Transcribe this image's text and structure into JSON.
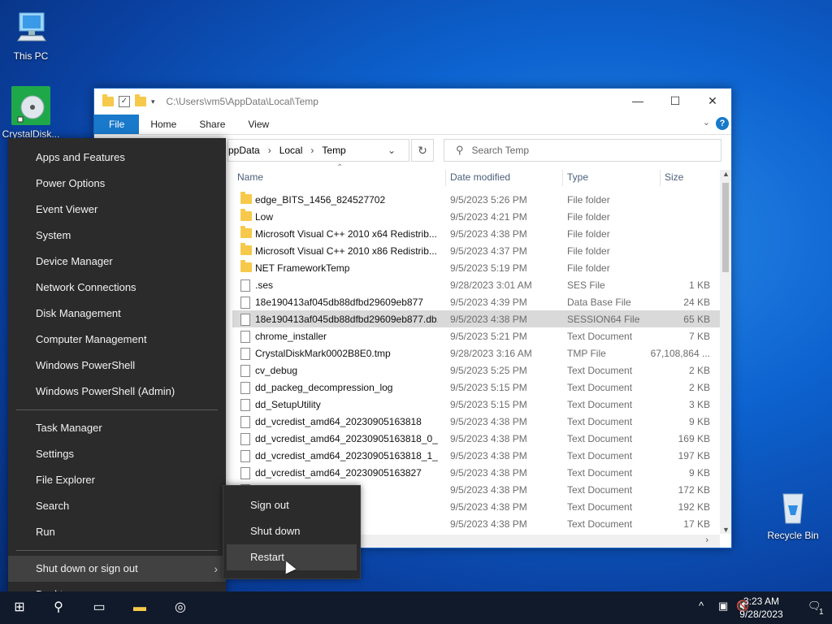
{
  "desktop": {
    "icons": [
      {
        "label": "This PC"
      },
      {
        "label": "CrystalDisk..."
      },
      {
        "label": "Recycle Bin"
      }
    ]
  },
  "explorer": {
    "title_path": "C:\\Users\\vm5\\AppData\\Local\\Temp",
    "ribbon_tabs": [
      "File",
      "Home",
      "Share",
      "View"
    ],
    "address": [
      "ppData",
      "Local",
      "Temp"
    ],
    "search_placeholder": "Search Temp",
    "columns": [
      "Name",
      "Date modified",
      "Type",
      "Size"
    ],
    "files": [
      {
        "name": "edge_BITS_1456_824527702",
        "date": "9/5/2023 5:26 PM",
        "type": "File folder",
        "size": "",
        "kind": "folder"
      },
      {
        "name": "Low",
        "date": "9/5/2023 4:21 PM",
        "type": "File folder",
        "size": "",
        "kind": "folder"
      },
      {
        "name": "Microsoft Visual C++ 2010  x64 Redistrib...",
        "date": "9/5/2023 4:38 PM",
        "type": "File folder",
        "size": "",
        "kind": "folder"
      },
      {
        "name": "Microsoft Visual C++ 2010  x86 Redistrib...",
        "date": "9/5/2023 4:37 PM",
        "type": "File folder",
        "size": "",
        "kind": "folder"
      },
      {
        "name": "NET FrameworkTemp",
        "date": "9/5/2023 5:19 PM",
        "type": "File folder",
        "size": "",
        "kind": "folder"
      },
      {
        "name": ".ses",
        "date": "9/28/2023 3:01 AM",
        "type": "SES File",
        "size": "1 KB",
        "kind": "file"
      },
      {
        "name": "18e190413af045db88dfbd29609eb877",
        "date": "9/5/2023 4:39 PM",
        "type": "Data Base File",
        "size": "24 KB",
        "kind": "file"
      },
      {
        "name": "18e190413af045db88dfbd29609eb877.db....",
        "date": "9/5/2023 4:38 PM",
        "type": "SESSION64 File",
        "size": "65 KB",
        "kind": "file",
        "selected": true
      },
      {
        "name": "chrome_installer",
        "date": "9/5/2023 5:21 PM",
        "type": "Text Document",
        "size": "7 KB",
        "kind": "file"
      },
      {
        "name": "CrystalDiskMark0002B8E0.tmp",
        "date": "9/28/2023 3:16 AM",
        "type": "TMP File",
        "size": "67,108,864 ...",
        "kind": "file"
      },
      {
        "name": "cv_debug",
        "date": "9/5/2023 5:25 PM",
        "type": "Text Document",
        "size": "2 KB",
        "kind": "file"
      },
      {
        "name": "dd_packeg_decompression_log",
        "date": "9/5/2023 5:15 PM",
        "type": "Text Document",
        "size": "2 KB",
        "kind": "file"
      },
      {
        "name": "dd_SetupUtility",
        "date": "9/5/2023 5:15 PM",
        "type": "Text Document",
        "size": "3 KB",
        "kind": "file"
      },
      {
        "name": "dd_vcredist_amd64_20230905163818",
        "date": "9/5/2023 4:38 PM",
        "type": "Text Document",
        "size": "9 KB",
        "kind": "file"
      },
      {
        "name": "dd_vcredist_amd64_20230905163818_0_v...",
        "date": "9/5/2023 4:38 PM",
        "type": "Text Document",
        "size": "169 KB",
        "kind": "file"
      },
      {
        "name": "dd_vcredist_amd64_20230905163818_1_v...",
        "date": "9/5/2023 4:38 PM",
        "type": "Text Document",
        "size": "197 KB",
        "kind": "file"
      },
      {
        "name": "dd_vcredist_amd64_20230905163827",
        "date": "9/5/2023 4:38 PM",
        "type": "Text Document",
        "size": "9 KB",
        "kind": "file"
      },
      {
        "name": "0905163827_000...",
        "date": "9/5/2023 4:38 PM",
        "type": "Text Document",
        "size": "172 KB",
        "kind": "file"
      },
      {
        "name": "0905163827_001...",
        "date": "9/5/2023 4:38 PM",
        "type": "Text Document",
        "size": "192 KB",
        "kind": "file"
      },
      {
        "name": "0905163838",
        "date": "9/5/2023 4:38 PM",
        "type": "Text Document",
        "size": "17 KB",
        "kind": "file"
      }
    ]
  },
  "winx_menu": {
    "group1": [
      "Apps and Features",
      "Power Options",
      "Event Viewer",
      "System",
      "Device Manager",
      "Network Connections",
      "Disk Management",
      "Computer Management",
      "Windows PowerShell",
      "Windows PowerShell (Admin)"
    ],
    "group2": [
      "Task Manager",
      "Settings",
      "File Explorer",
      "Search",
      "Run"
    ],
    "group3": [
      "Shut down or sign out",
      "Desktop"
    ]
  },
  "submenu": [
    "Sign out",
    "Shut down",
    "Restart"
  ],
  "taskbar": {
    "time": "3:23 AM",
    "date": "9/28/2023",
    "notification_count": "1"
  }
}
